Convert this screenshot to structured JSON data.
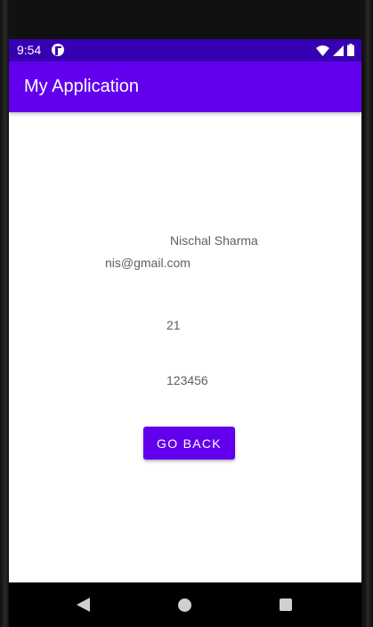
{
  "status_bar": {
    "time": "9:54",
    "icons": [
      "app-notification-icon",
      "wifi-icon",
      "signal-icon",
      "battery-icon"
    ]
  },
  "app_bar": {
    "title": "My Application",
    "color": "#6200ee"
  },
  "content": {
    "name": "Nischal Sharma",
    "email": "nis@gmail.com",
    "age": "21",
    "password": "123456"
  },
  "button": {
    "label": "GO BACK",
    "color": "#6200ee"
  },
  "nav_bar": {
    "icons": [
      "back-icon",
      "home-icon",
      "recents-icon"
    ]
  }
}
